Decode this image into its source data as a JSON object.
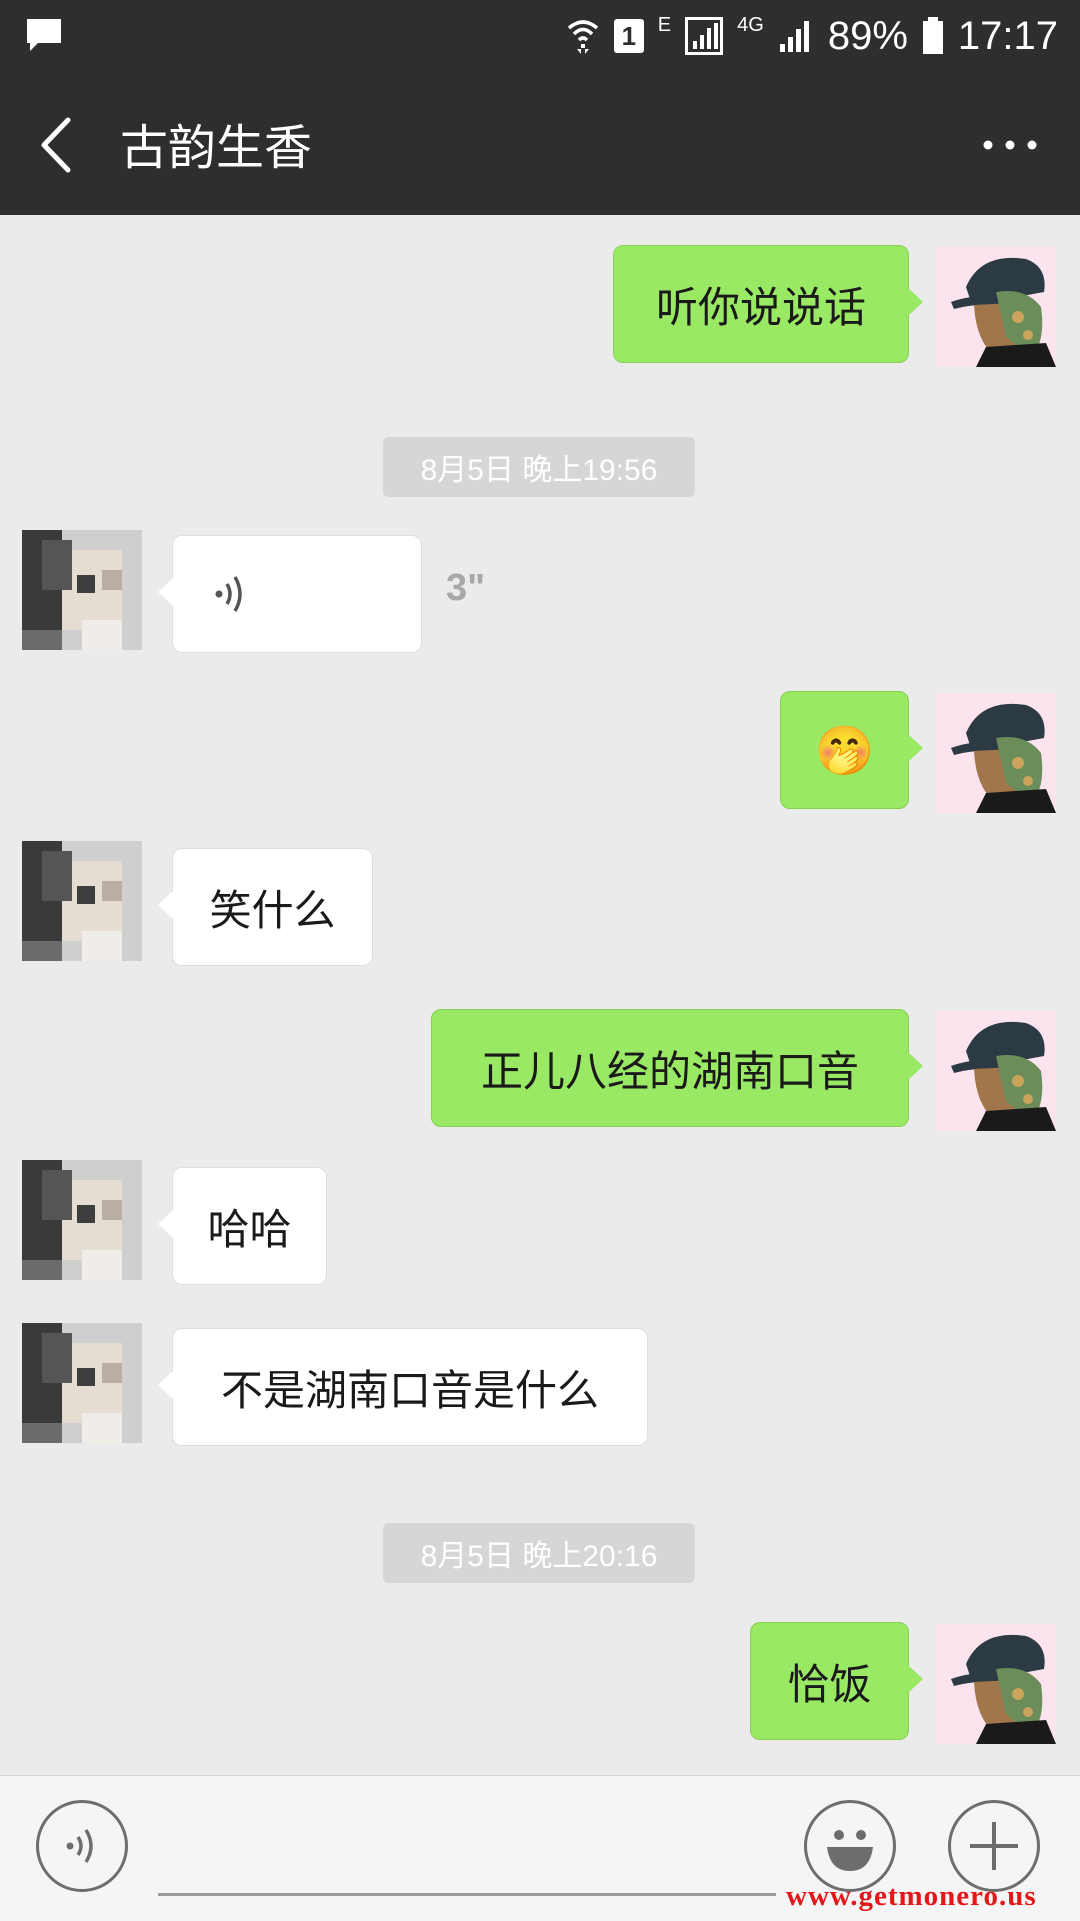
{
  "status_bar": {
    "sim_slot": "1",
    "network_e": "E",
    "network_4g": "4G",
    "battery": "89%",
    "time": "17:17"
  },
  "header": {
    "title": "古韵生香"
  },
  "messages": [
    {
      "type": "text",
      "sender": "self",
      "text": "听你说说话"
    },
    {
      "type": "timestamp",
      "text": "8月5日 晚上19:56"
    },
    {
      "type": "voice",
      "sender": "peer",
      "duration": "3\""
    },
    {
      "type": "emoji",
      "sender": "self",
      "emoji": "🤭"
    },
    {
      "type": "text",
      "sender": "peer",
      "text": "笑什么"
    },
    {
      "type": "text",
      "sender": "self",
      "text": "正儿八经的湖南口音"
    },
    {
      "type": "text",
      "sender": "peer",
      "text": "哈哈"
    },
    {
      "type": "text",
      "sender": "peer",
      "text": "不是湖南口音是什么"
    },
    {
      "type": "timestamp",
      "text": "8月5日 晚上20:16"
    },
    {
      "type": "text",
      "sender": "self",
      "text": "恰饭"
    }
  ],
  "input_bar": {
    "voice_icon": "voice-input-icon",
    "emoji_icon": "smiley-icon",
    "more_icon": "plus-icon"
  },
  "watermark": "www.getmonero.us",
  "colors": {
    "header_bg": "#2e2e2e",
    "chat_bg": "#ebebeb",
    "self_bubble": "#9ae965",
    "peer_bubble": "#ffffff",
    "timestamp_bg": "#d6d6d6",
    "watermark": "#e21818"
  }
}
